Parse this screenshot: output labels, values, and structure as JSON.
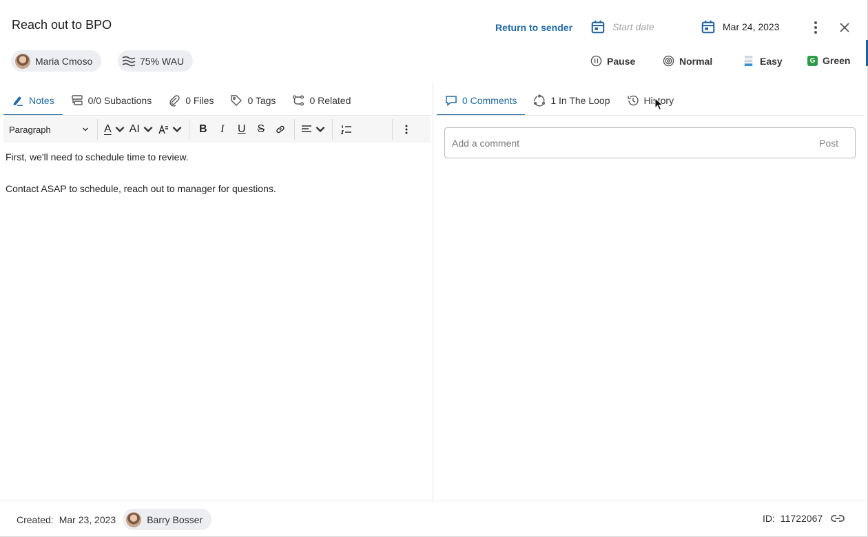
{
  "header": {
    "title": "Reach out to BPO",
    "return_label": "Return to sender",
    "start_date_placeholder": "Start date",
    "due_date": "Mar 24, 2023",
    "more_icon": "more-vertical-icon",
    "close_icon": "close-icon"
  },
  "chips": {
    "assignee": "Maria Cmoso",
    "wau": "75% WAU"
  },
  "status": {
    "pause": "Pause",
    "priority": "Normal",
    "effort": "Easy",
    "color_label": "Green",
    "color_badge": "G",
    "color_hex": "#2e9b4a"
  },
  "left_tabs": [
    {
      "label": "Notes",
      "icon": "pen-icon",
      "active": true
    },
    {
      "label": "0/0 Subactions",
      "icon": "subactions-icon",
      "active": false
    },
    {
      "label": "0 Files",
      "icon": "paperclip-icon",
      "active": false
    },
    {
      "label": "0 Tags",
      "icon": "tag-icon",
      "active": false
    },
    {
      "label": "0 Related",
      "icon": "related-icon",
      "active": false
    }
  ],
  "right_tabs": [
    {
      "label": "0 Comments",
      "icon": "comment-icon",
      "active": true
    },
    {
      "label": "1 In The Loop",
      "icon": "loop-icon",
      "active": false
    },
    {
      "label": "History",
      "icon": "history-icon",
      "active": false
    }
  ],
  "toolbar": {
    "paragraph": "Paragraph",
    "font_color_glyph": "A",
    "font_size_glyph": "AI",
    "bold": "B",
    "italic": "I",
    "underline": "U",
    "strike": "S"
  },
  "notes": {
    "line1": "First, we'll need to schedule time to review.",
    "line2": "Contact ASAP to schedule, reach out to manager for questions."
  },
  "comment": {
    "placeholder": "Add a comment",
    "post_label": "Post"
  },
  "footer": {
    "created_label": "Created:",
    "created_date": "Mar 23, 2023",
    "creator": "Barry Bosser",
    "id_label": "ID:",
    "id_value": "11722067"
  },
  "colors": {
    "accent": "#1f6aa5",
    "calendar": "#1f5f99"
  }
}
